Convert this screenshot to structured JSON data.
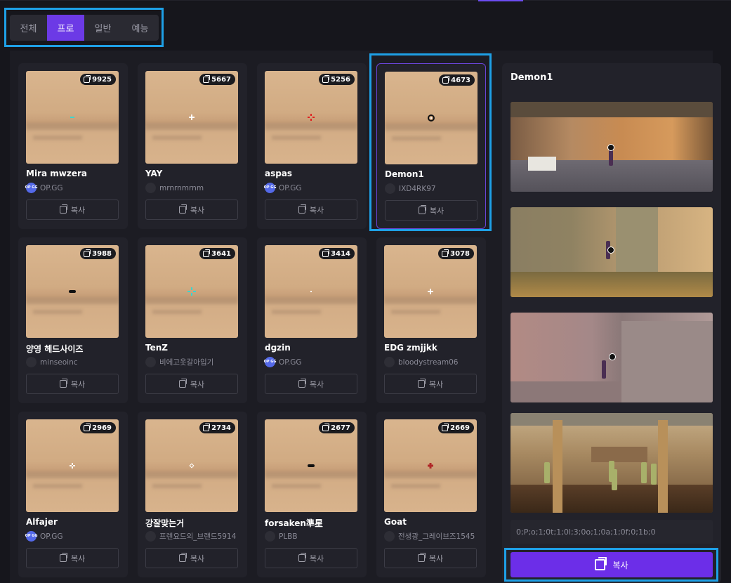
{
  "tabs": [
    {
      "label": "전체",
      "active": false
    },
    {
      "label": "프로",
      "active": true
    },
    {
      "label": "일반",
      "active": false
    },
    {
      "label": "예능",
      "active": false
    }
  ],
  "cards": [
    {
      "name": "Mira mwzera",
      "author": "OP.GG",
      "author_badge": "OP GG",
      "count": "9925",
      "crosshair": "dot-cyan",
      "color": "#3ad6d0"
    },
    {
      "name": "YAY",
      "author": "mrnrnmrnm",
      "author_badge": "",
      "count": "5667",
      "crosshair": "plus-white",
      "color": "#ffffff"
    },
    {
      "name": "aspas",
      "author": "OP.GG",
      "author_badge": "OP GG",
      "count": "5256",
      "crosshair": "cross-red",
      "color": "#e02020"
    },
    {
      "name": "Demon1",
      "author": "IXD4RK97",
      "author_badge": "",
      "count": "4673",
      "crosshair": "circle-black",
      "color": "#111111"
    },
    {
      "name": "양영 헤드사이즈",
      "author": "minseoinc",
      "author_badge": "",
      "count": "3988",
      "crosshair": "bar-black",
      "color": "#111111"
    },
    {
      "name": "TenZ",
      "author": "비에고옷갈아입기",
      "author_badge": "",
      "count": "3641",
      "crosshair": "cross-cyan",
      "color": "#3ad6d0"
    },
    {
      "name": "dgzin",
      "author": "OP.GG",
      "author_badge": "OP GG",
      "count": "3414",
      "crosshair": "dot-white",
      "color": "#ffffff"
    },
    {
      "name": "EDG zmjjkk",
      "author": "bloodystream06",
      "author_badge": "",
      "count": "3078",
      "crosshair": "plus-white",
      "color": "#ffffff"
    },
    {
      "name": "Alfajer",
      "author": "OP.GG",
      "author_badge": "OP GG",
      "count": "2969",
      "crosshair": "cross-white",
      "color": "#ffffff"
    },
    {
      "name": "강잘맞는거",
      "author": "프렌요드의_브랜드5914",
      "author_badge": "",
      "count": "2734",
      "crosshair": "diamond-white",
      "color": "#ffffff"
    },
    {
      "name": "forsaken準星",
      "author": "PLBB",
      "author_badge": "",
      "count": "2677",
      "crosshair": "bar-black",
      "color": "#111111"
    },
    {
      "name": "Goat",
      "author": "전생광_그레이브즈1545",
      "author_badge": "",
      "count": "2669",
      "crosshair": "plus-red",
      "color": "#b02828"
    }
  ],
  "card_copy_label": "복사",
  "detail": {
    "title": "Demon1",
    "code": "0;P;o;1;0t;1;0l;3;0o;1;0a;1;0f;0;1b;0",
    "copy_label": "복사"
  },
  "colors": {
    "accent": "#6c2ee8",
    "highlight": "#1ea0e6",
    "background": "#16161c"
  }
}
